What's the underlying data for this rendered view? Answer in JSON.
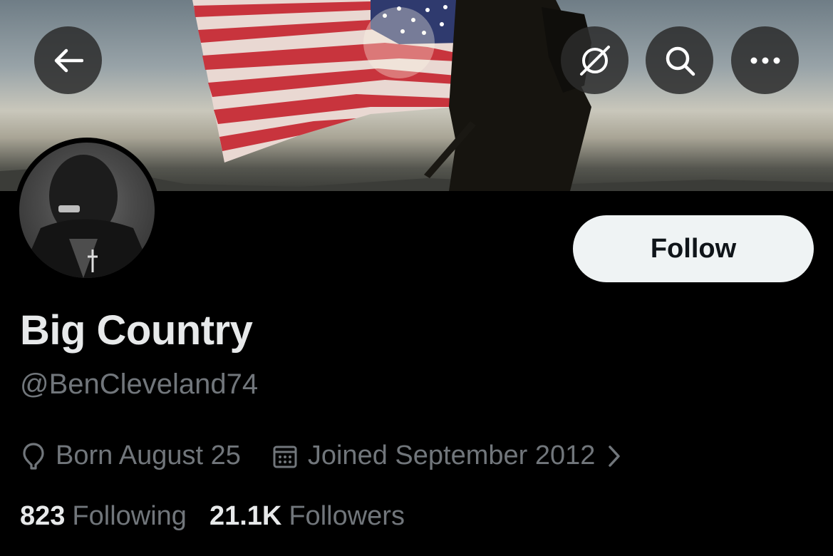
{
  "profile": {
    "display_name": "Big Country",
    "handle": "@BenCleveland74",
    "birthday": "Born August 25",
    "joined": "Joined September 2012",
    "following_count": "823",
    "following_label": "Following",
    "followers_count": "21.1K",
    "followers_label": "Followers"
  },
  "actions": {
    "follow_label": "Follow"
  },
  "icons": {
    "back": "arrow-left-icon",
    "grok": "grok-icon",
    "search": "search-icon",
    "more": "more-icon",
    "location": "location-pin-icon",
    "calendar": "calendar-icon",
    "chevron": "chevron-right-icon"
  },
  "colors": {
    "background": "#000000",
    "primary_text": "#e7e9ea",
    "secondary_text": "#71767b",
    "follow_button_bg": "#eff3f4",
    "follow_button_text": "#0f1419"
  }
}
